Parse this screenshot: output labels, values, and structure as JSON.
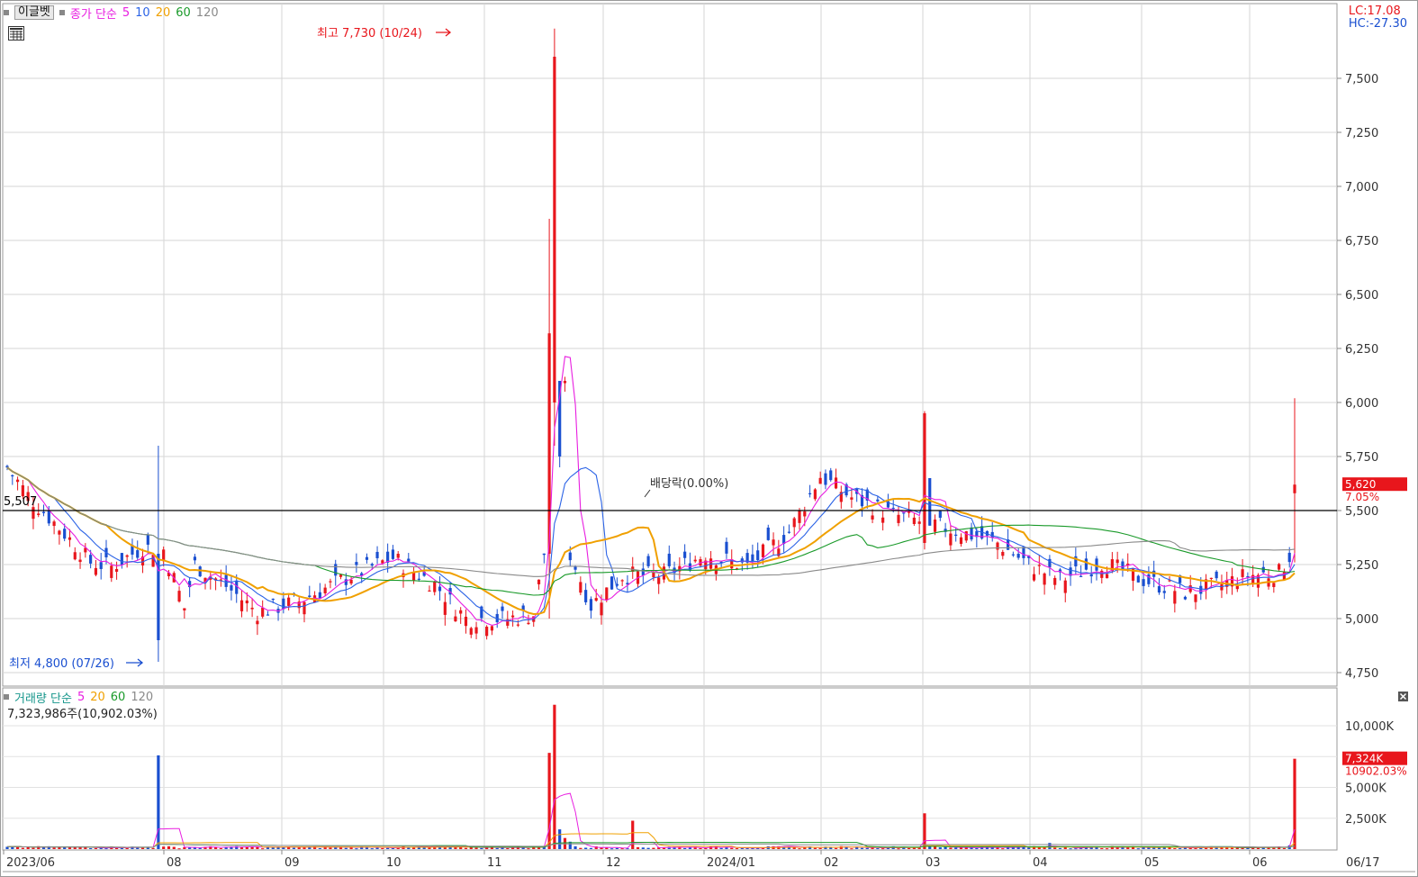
{
  "price_legend": {
    "name": "이글벳",
    "label": "종가 단순",
    "periods": [
      "5",
      "10",
      "20",
      "60",
      "120"
    ]
  },
  "volume_legend": {
    "label": "거래량 단순",
    "periods": [
      "5",
      "20",
      "60",
      "120"
    ]
  },
  "volume_info": "7,323,986주(10,902.03%)",
  "corner": {
    "lc": "LC:17.08",
    "hc": "HC:-27.30"
  },
  "colors": {
    "up": "#e8161c",
    "down": "#1a4fd0",
    "ma5": "#e81ee0",
    "ma10": "#2b63e6",
    "ma20": "#f0a000",
    "ma60": "#1a9a2a",
    "ma120": "#8a8a8a",
    "vol_label": "#14958a"
  },
  "icons": [
    "grid-icon",
    "close-icon"
  ],
  "chart_data": [
    {
      "type": "candlestick",
      "title": "",
      "x_tick_labels": [
        "2023/06",
        "08",
        "09",
        "10",
        "11",
        "12",
        "2024/01",
        "02",
        "03",
        "04",
        "05",
        "06",
        "06/17"
      ],
      "y_tick_labels": [
        "7,500",
        "7,250",
        "7,000",
        "6,750",
        "6,500",
        "6,250",
        "6,000",
        "5,750",
        "5,500",
        "5,250",
        "5,000",
        "4,750"
      ],
      "ylim": [
        4680,
        7800
      ],
      "series_names": [
        "5",
        "10",
        "20",
        "60",
        "120"
      ],
      "annotations": {
        "high": "최고 7,730 (10/24)",
        "low": "최저 4,800 (07/26)",
        "dividend": "배당락(0.00%)",
        "ref_line_value": 5500,
        "ref_line_label": "5,507",
        "last_price": "5,620",
        "last_change": "7.05%"
      },
      "anchors_price": [
        {
          "m": "2023/06",
          "open": 5700,
          "high": 5800,
          "low": 5500,
          "close": 5560
        },
        {
          "m": "07 start",
          "open": 5420,
          "high": 5460,
          "low": 5120,
          "close": 5200
        },
        {
          "m": "07/26",
          "open": 5300,
          "high": 5800,
          "low": 4800,
          "close": 4900
        },
        {
          "m": "08",
          "open": 5200,
          "high": 5320,
          "low": 5100,
          "close": 5250
        },
        {
          "m": "08 mid",
          "open": 5050,
          "high": 5120,
          "low": 4950,
          "close": 5000
        },
        {
          "m": "09",
          "open": 5150,
          "high": 5300,
          "low": 5050,
          "close": 5250
        },
        {
          "m": "10",
          "open": 5000,
          "high": 5050,
          "low": 4930,
          "close": 4980
        },
        {
          "m": "10/24",
          "open": 5300,
          "high": 7730,
          "low": 5000,
          "close": 7600
        },
        {
          "m": "11",
          "open": 5100,
          "high": 5500,
          "low": 4950,
          "close": 5050
        },
        {
          "m": "12",
          "open": 5650,
          "high": 5790,
          "low": 5400,
          "close": 5700
        },
        {
          "m": "2024/01",
          "open": 5450,
          "high": 5500,
          "low": 5250,
          "close": 5400
        },
        {
          "m": "01 spike",
          "open": 5350,
          "high": 5960,
          "low": 5320,
          "close": 5900
        },
        {
          "m": "02",
          "open": 5200,
          "high": 5280,
          "low": 5100,
          "close": 5150
        },
        {
          "m": "03",
          "open": 5100,
          "high": 5200,
          "low": 5030,
          "close": 5120
        },
        {
          "m": "04",
          "open": 5200,
          "high": 5580,
          "low": 5120,
          "close": 5220
        },
        {
          "m": "05",
          "open": 5250,
          "high": 5350,
          "low": 5150,
          "close": 5300
        },
        {
          "m": "05 late",
          "open": 5400,
          "high": 5620,
          "low": 5200,
          "close": 5550
        },
        {
          "m": "06/17",
          "open": 5260,
          "high": 6020,
          "low": 5260,
          "close": 5620
        }
      ]
    },
    {
      "type": "bar",
      "title": "",
      "y_tick_labels": [
        "10,000K",
        "7,500K",
        "5,000K",
        "2,500K"
      ],
      "ylim": [
        0,
        11800
      ],
      "series_names": [
        "5",
        "20",
        "60",
        "120"
      ],
      "annotations": {
        "last_volume": "7,324K",
        "last_ratio": "10902.03%"
      },
      "anchors_volume_k": [
        {
          "m": "07/26",
          "value": 7600
        },
        {
          "m": "10/23",
          "value": 7800
        },
        {
          "m": "10/24",
          "value": 11700
        },
        {
          "m": "11 spike",
          "value": 2300
        },
        {
          "m": "01 spike",
          "value": 2900
        },
        {
          "m": "06/17",
          "value": 7324
        }
      ]
    }
  ]
}
